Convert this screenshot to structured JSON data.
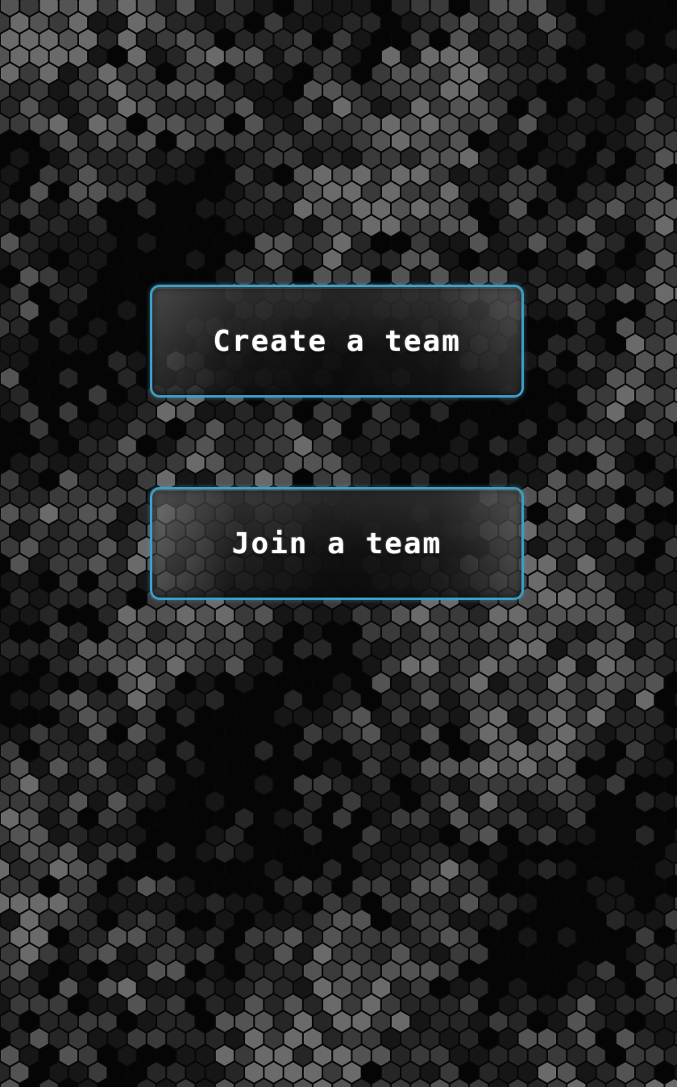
{
  "screen": {
    "background": "hexagon-pattern",
    "background_colors": [
      "#050505",
      "#161616",
      "#262626",
      "#3a3a3a",
      "#535353",
      "#6a6a6a"
    ]
  },
  "buttons": {
    "create_team": {
      "label": "Create a team"
    },
    "join_team": {
      "label": "Join a team"
    }
  },
  "style": {
    "button_border_color": "#3d9ec4",
    "button_text_color": "#ffffff"
  }
}
